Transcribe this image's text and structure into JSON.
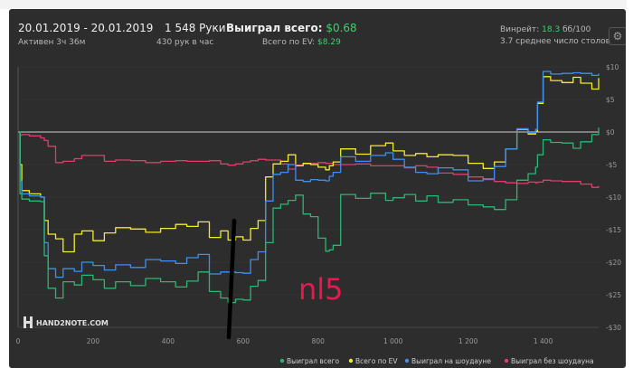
{
  "header": {
    "date_range": "20.01.2019 - 20.01.2019",
    "active_time": "Активен 3ч 36м",
    "hands": "1 548 Руки",
    "hands_per_hour": "430 рук в час",
    "won_total_label": "Выиграл всего:",
    "won_total_value": "$0.68",
    "ev_label": "Всего по EV:",
    "ev_value": "$8.29",
    "winrate_label": "Винрейт:",
    "winrate_value": "18.3",
    "winrate_unit": "бб/100",
    "tables": "3.7 среднее число столов"
  },
  "watermark": {
    "brand": "HAND2NOTE.COM"
  },
  "annotation": {
    "text": "nl5"
  },
  "colors": {
    "won_total": "#2bb673",
    "ev": "#f2ec2a",
    "showdown": "#3f8ef0",
    "non_showdown": "#e03c6c",
    "zero_line": "#cfcfcf",
    "annotation": "#e8194f"
  },
  "chart_data": {
    "type": "line",
    "xlim": [
      0,
      1548
    ],
    "ylim": [
      -30,
      10
    ],
    "x_ticks": [
      0,
      200,
      400,
      600,
      800,
      1000,
      1200,
      1400
    ],
    "x_tick_labels": [
      "0",
      "200",
      "400",
      "600",
      "800",
      "1 000",
      "1 200",
      "1 400"
    ],
    "y_ticks": [
      10,
      5,
      0,
      -5,
      -10,
      -15,
      -20,
      -25,
      -30
    ],
    "y_tick_labels": [
      "$10",
      "$5",
      "$0",
      "-$5",
      "-$10",
      "-$15",
      "-$20",
      "-$25",
      "-$30"
    ],
    "legend": "bottom-right",
    "series": [
      {
        "name": "Выиграл всего",
        "x": [
          0,
          5,
          10,
          30,
          60,
          70,
          80,
          100,
          120,
          150,
          170,
          200,
          230,
          260,
          300,
          340,
          380,
          420,
          450,
          480,
          510,
          540,
          560,
          580,
          600,
          620,
          640,
          660,
          680,
          700,
          720,
          740,
          760,
          780,
          800,
          820,
          830,
          840,
          860,
          900,
          940,
          980,
          1000,
          1030,
          1060,
          1090,
          1120,
          1160,
          1200,
          1240,
          1270,
          1300,
          1330,
          1360,
          1380,
          1385,
          1400,
          1420,
          1450,
          1480,
          1500,
          1530,
          1548
        ],
        "y": [
          0,
          -9.5,
          -10.3,
          -10.6,
          -10.7,
          -19,
          -24,
          -25.5,
          -23,
          -23.5,
          -22,
          -22.7,
          -24,
          -23,
          -23.6,
          -22.5,
          -23,
          -23.8,
          -22.9,
          -21.5,
          -24.5,
          -25.5,
          -26.2,
          -25.7,
          -25.8,
          -23.7,
          -22.8,
          -17,
          -11.7,
          -11.1,
          -10.5,
          -9.7,
          -12.6,
          -13,
          -16.3,
          -18.3,
          -18.1,
          -17.4,
          -9.6,
          -10.2,
          -9.4,
          -10.5,
          -10.1,
          -9.6,
          -10.6,
          -9.8,
          -10.8,
          -10.4,
          -11.2,
          -11.5,
          -11.9,
          -10.4,
          -7.4,
          -6.4,
          -5.4,
          -3.5,
          -1.2,
          -1.6,
          -1.7,
          -2.5,
          -1.5,
          -0.4,
          0.68
        ]
      },
      {
        "name": "Всего по EV",
        "x": [
          0,
          5,
          10,
          30,
          60,
          70,
          80,
          100,
          120,
          150,
          170,
          200,
          230,
          260,
          300,
          340,
          380,
          420,
          450,
          480,
          510,
          540,
          560,
          580,
          600,
          620,
          640,
          660,
          680,
          700,
          720,
          740,
          760,
          780,
          800,
          820,
          830,
          840,
          860,
          900,
          940,
          980,
          1000,
          1030,
          1060,
          1090,
          1120,
          1160,
          1200,
          1240,
          1270,
          1300,
          1330,
          1360,
          1380,
          1385,
          1400,
          1420,
          1450,
          1480,
          1500,
          1530,
          1548
        ],
        "y": [
          0,
          -5,
          -9,
          -9.5,
          -10,
          -13.6,
          -15.7,
          -16.4,
          -18.4,
          -15.7,
          -15.2,
          -16.7,
          -15.5,
          -14.7,
          -14.9,
          -15.4,
          -14.8,
          -14.2,
          -14.5,
          -13.8,
          -16.2,
          -15.2,
          -16.6,
          -16.1,
          -16.6,
          -14.8,
          -13.6,
          -6.9,
          -4.9,
          -4.5,
          -3.5,
          -5.2,
          -4.8,
          -5,
          -5.4,
          -5.8,
          -5.2,
          -4.6,
          -2.6,
          -3.4,
          -2.1,
          -1.7,
          -2.9,
          -3.6,
          -3.3,
          -3.8,
          -3.5,
          -3.6,
          -4.8,
          -5.6,
          -4.6,
          -2.6,
          0.4,
          -0.3,
          0.1,
          4.4,
          8.5,
          7.9,
          7.6,
          8.4,
          7.5,
          6.6,
          8.29
        ]
      },
      {
        "name": "Выиграл на шоудауне",
        "x": [
          0,
          5,
          10,
          30,
          60,
          70,
          80,
          100,
          120,
          150,
          170,
          200,
          230,
          260,
          300,
          340,
          380,
          420,
          450,
          480,
          510,
          540,
          560,
          580,
          600,
          620,
          640,
          660,
          680,
          700,
          720,
          740,
          760,
          780,
          800,
          820,
          830,
          840,
          860,
          900,
          940,
          980,
          1000,
          1030,
          1060,
          1090,
          1120,
          1160,
          1200,
          1240,
          1270,
          1300,
          1330,
          1360,
          1380,
          1385,
          1400,
          1420,
          1450,
          1480,
          1500,
          1530,
          1548
        ],
        "y": [
          0,
          -7.5,
          -9.5,
          -9.8,
          -10,
          -17,
          -21,
          -22.3,
          -21,
          -21.4,
          -20,
          -20.5,
          -21.2,
          -20.4,
          -20.8,
          -19.6,
          -19.8,
          -20.2,
          -19.3,
          -18.8,
          -21.8,
          -21.5,
          -21.5,
          -21.6,
          -21.7,
          -19.6,
          -18.4,
          -10.6,
          -6.5,
          -6.2,
          -5,
          -7.4,
          -7.6,
          -7.3,
          -7.4,
          -7.5,
          -6.8,
          -6.2,
          -3.8,
          -4.5,
          -3.6,
          -3.2,
          -4.2,
          -5.4,
          -6.2,
          -6.4,
          -5.5,
          -5.8,
          -7.5,
          -7.2,
          -5.3,
          -2.6,
          0.5,
          -0.1,
          0.4,
          4.6,
          9.3,
          8.9,
          9,
          9.1,
          9,
          8.7,
          9
        ]
      },
      {
        "name": "Выиграл без шоудауна",
        "x": [
          0,
          5,
          10,
          30,
          60,
          70,
          80,
          100,
          120,
          150,
          170,
          200,
          230,
          260,
          300,
          340,
          380,
          420,
          450,
          480,
          510,
          540,
          560,
          580,
          600,
          620,
          640,
          660,
          680,
          700,
          720,
          740,
          760,
          780,
          800,
          820,
          830,
          840,
          860,
          900,
          940,
          980,
          1000,
          1030,
          1060,
          1090,
          1120,
          1160,
          1200,
          1240,
          1270,
          1300,
          1330,
          1360,
          1380,
          1385,
          1400,
          1420,
          1450,
          1480,
          1500,
          1530,
          1548
        ],
        "y": [
          0,
          -0.5,
          -0.4,
          -0.6,
          -0.9,
          -1.3,
          -2.2,
          -4.7,
          -4.5,
          -4.1,
          -3.6,
          -3.6,
          -4.5,
          -4.3,
          -4.4,
          -4.7,
          -4.5,
          -4.4,
          -4.5,
          -4.5,
          -4.4,
          -4.9,
          -5.1,
          -4.9,
          -4.6,
          -4.4,
          -4.2,
          -4.3,
          -4.3,
          -4.9,
          -5.7,
          -5.1,
          -4.9,
          -4.8,
          -4.7,
          -4.8,
          -4.8,
          -5,
          -5,
          -4.9,
          -5.2,
          -5.2,
          -5.2,
          -5.5,
          -5.2,
          -5.4,
          -6.3,
          -6.5,
          -6.9,
          -7.3,
          -7.6,
          -7.8,
          -7.9,
          -7.7,
          -7.8,
          -7.7,
          -7.4,
          -7.5,
          -7.6,
          -7.6,
          -8,
          -8.5,
          -8.3
        ]
      }
    ]
  }
}
